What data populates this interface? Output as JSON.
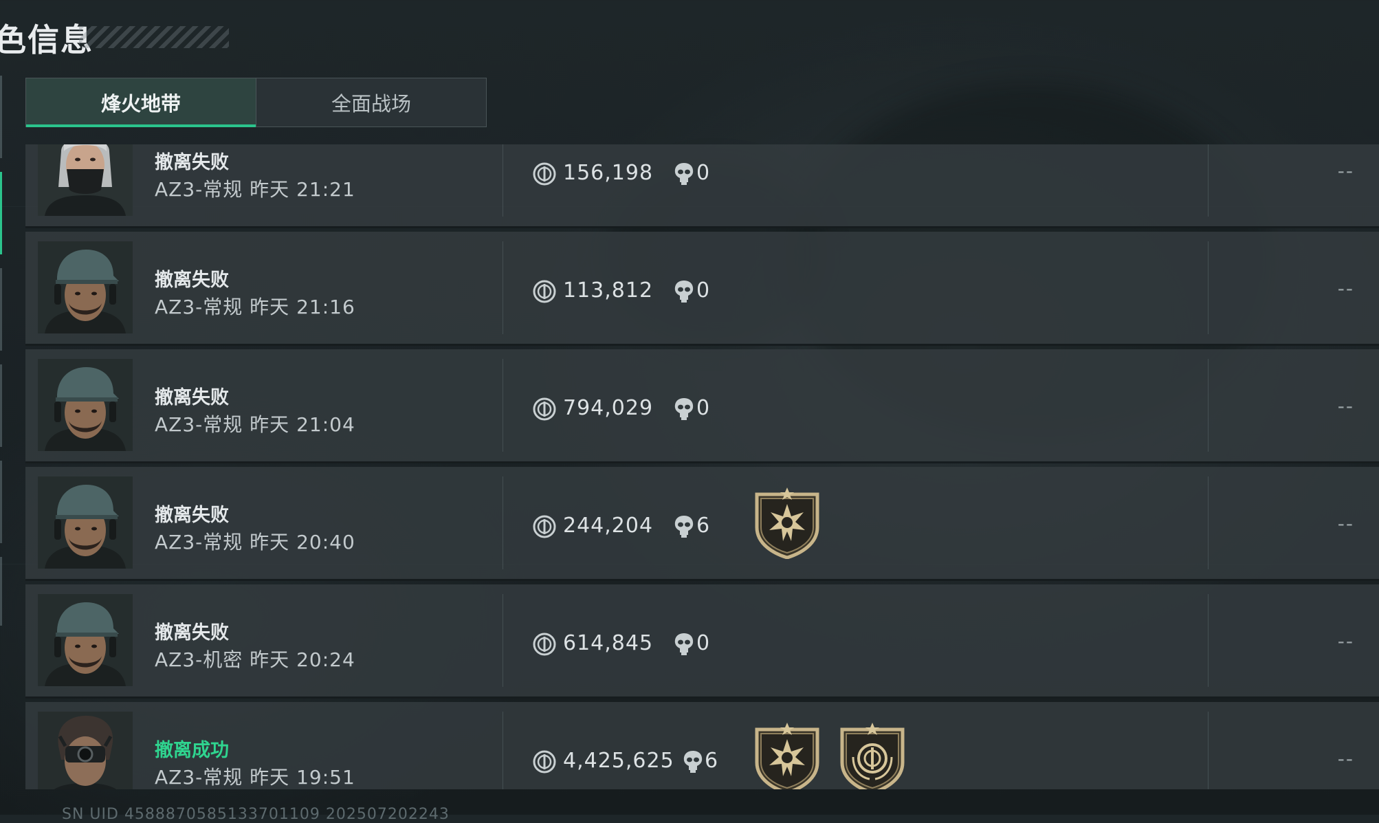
{
  "header": {
    "title": "色信息"
  },
  "tabs": [
    {
      "label": "烽火地带",
      "active": true
    },
    {
      "label": "全面战场",
      "active": false
    }
  ],
  "records": [
    {
      "status": "撤离失败",
      "status_color": "#e4e8ea",
      "mode": "AZ3-常规",
      "time": "昨天 21:21",
      "value": "156,198",
      "kills": "0",
      "badges": [],
      "result": "--",
      "avatar": "female-masked-operator"
    },
    {
      "status": "撤离失败",
      "status_color": "#e4e8ea",
      "mode": "AZ3-常规",
      "time": "昨天 21:16",
      "value": "113,812",
      "kills": "0",
      "badges": [],
      "result": "--",
      "avatar": "male-cap-headset-operator"
    },
    {
      "status": "撤离失败",
      "status_color": "#e4e8ea",
      "mode": "AZ3-常规",
      "time": "昨天 21:04",
      "value": "794,029",
      "kills": "0",
      "badges": [],
      "result": "--",
      "avatar": "male-cap-headset-operator"
    },
    {
      "status": "撤离失败",
      "status_color": "#e4e8ea",
      "mode": "AZ3-常规",
      "time": "昨天 20:40",
      "value": "244,204",
      "kills": "6",
      "badges": [
        "star-burst-badge"
      ],
      "result": "--",
      "avatar": "male-cap-headset-operator"
    },
    {
      "status": "撤离失败",
      "status_color": "#e4e8ea",
      "mode": "AZ3-机密",
      "time": "昨天 20:24",
      "value": "614,845",
      "kills": "0",
      "badges": [],
      "result": "--",
      "avatar": "male-cap-headset-operator"
    },
    {
      "status": "撤离成功",
      "status_color": "#2fd48f",
      "mode": "AZ3-常规",
      "time": "昨天 19:51",
      "value": "4,425,625",
      "kills": "6",
      "badges": [
        "star-burst-badge",
        "currency-laurel-badge"
      ],
      "result": "--",
      "avatar": "night-vision-operator"
    }
  ],
  "footer": {
    "text": "SN UID 4588870585133701109 202507202243"
  },
  "colors": {
    "accent": "#2bc48c",
    "success": "#2fd48f",
    "row_bg": "#343c40"
  }
}
